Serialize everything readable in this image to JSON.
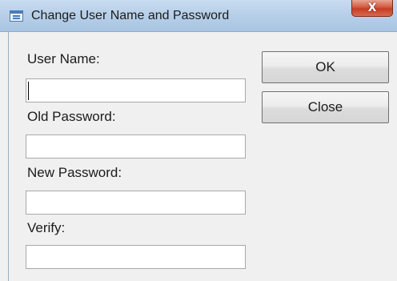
{
  "window": {
    "title": "Change User Name and Password",
    "close_glyph": "X",
    "icon": "form-window-icon"
  },
  "form": {
    "user_name_label": "User Name:",
    "user_name_value": "",
    "old_password_label": "Old Password:",
    "old_password_value": "",
    "new_password_label": "New Password:",
    "new_password_value": "",
    "verify_label": "Verify:",
    "verify_value": ""
  },
  "buttons": {
    "ok_label": "OK",
    "close_label": "Close"
  },
  "colors": {
    "titlebar": "#b9d1ea",
    "close_button": "#c43d25",
    "dialog_bg": "#f0f0f0"
  }
}
